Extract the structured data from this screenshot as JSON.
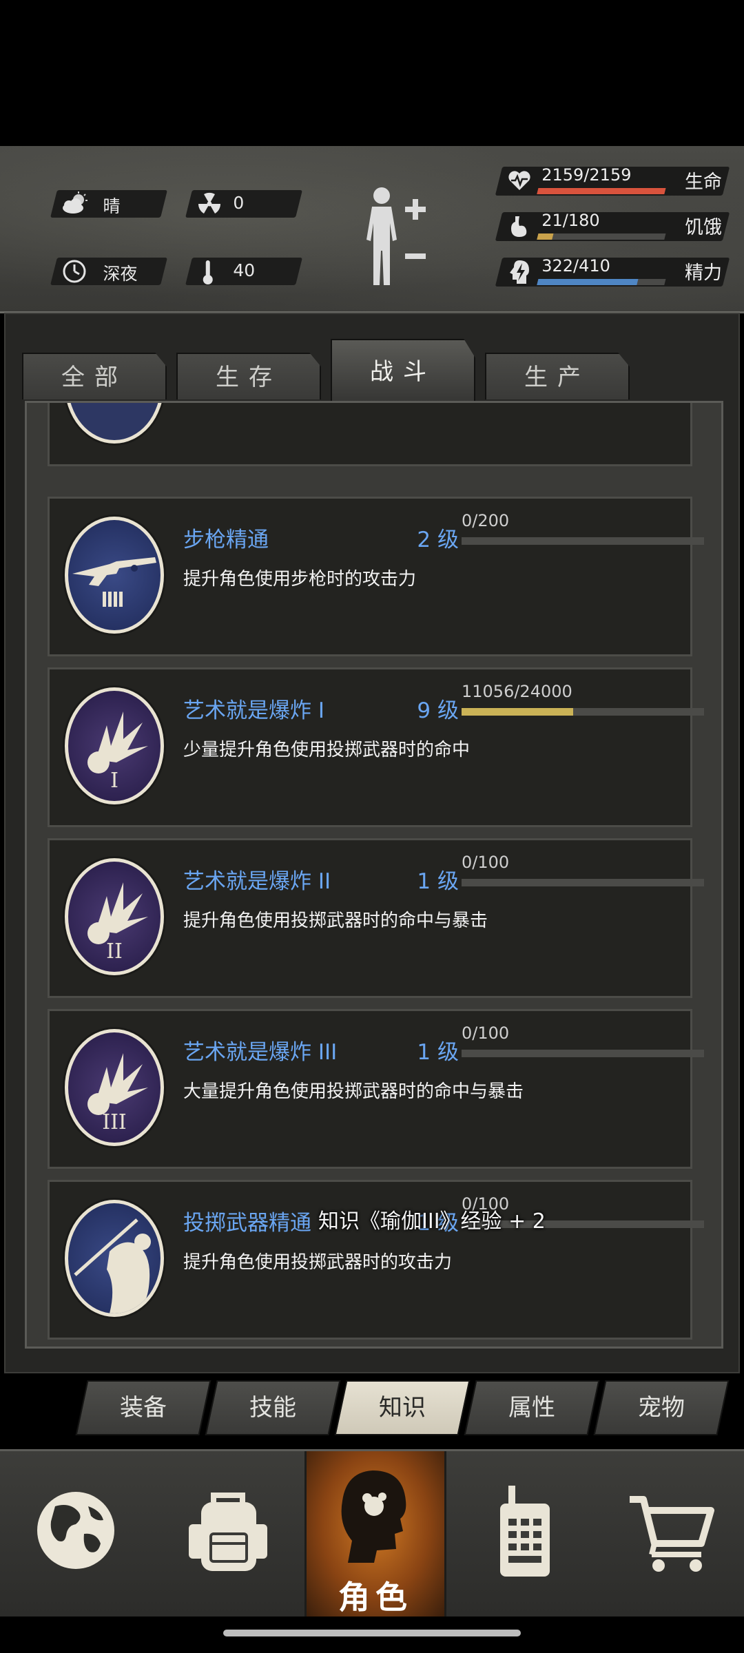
{
  "status": {
    "weather": "晴",
    "radiation": "0",
    "time_of_day": "深夜",
    "temperature": "40",
    "health": {
      "value": "2159/2159",
      "label": "生命",
      "fraction": 1.0,
      "color": "#d9533d"
    },
    "hunger": {
      "value": "21/180",
      "label": "饥饿",
      "fraction": 0.117,
      "color": "#c9a24b"
    },
    "energy": {
      "value": "322/410",
      "label": "精力",
      "fraction": 0.785,
      "color": "#4f86c4"
    }
  },
  "category_tabs": [
    "全部",
    "生存",
    "战斗",
    "生产"
  ],
  "category_active": "战斗",
  "skills": [
    {
      "name": "步枪精通",
      "level": "2 级",
      "progress": "0/200",
      "fraction": 0.0,
      "desc": "提升角色使用步枪时的攻击力",
      "icon": "rifle-medal-icon"
    },
    {
      "name": "艺术就是爆炸 I",
      "level": "9 级",
      "progress": "11056/24000",
      "fraction": 0.46,
      "desc": "少量提升角色使用投掷武器时的命中",
      "icon": "explosion-medal-1-icon"
    },
    {
      "name": "艺术就是爆炸 II",
      "level": "1 级",
      "progress": "0/100",
      "fraction": 0.0,
      "desc": "提升角色使用投掷武器时的命中与暴击",
      "icon": "explosion-medal-2-icon"
    },
    {
      "name": "艺术就是爆炸 III",
      "level": "1 级",
      "progress": "0/100",
      "fraction": 0.0,
      "desc": "大量提升角色使用投掷武器时的命中与暴击",
      "icon": "explosion-medal-3-icon"
    },
    {
      "name": "投掷武器精通",
      "level": "1 级",
      "progress": "0/100",
      "fraction": 0.0,
      "desc": "提升角色使用投掷武器时的攻击力",
      "icon": "throwing-medal-icon"
    }
  ],
  "toast": "知识《瑜伽III》经验 + 2",
  "sub_tabs": [
    "装备",
    "技能",
    "知识",
    "属性",
    "宠物"
  ],
  "sub_tab_active": "知识",
  "bottom_nav": [
    {
      "icon": "globe-icon",
      "label": ""
    },
    {
      "icon": "backpack-icon",
      "label": ""
    },
    {
      "icon": "character-head-icon",
      "label": "角色"
    },
    {
      "icon": "walkie-talkie-icon",
      "label": ""
    },
    {
      "icon": "shopping-cart-icon",
      "label": ""
    }
  ],
  "colors": {
    "skill_name": "#6aa6f2",
    "active_nav": "#d07a24",
    "xp_fill": "#cbb357"
  }
}
